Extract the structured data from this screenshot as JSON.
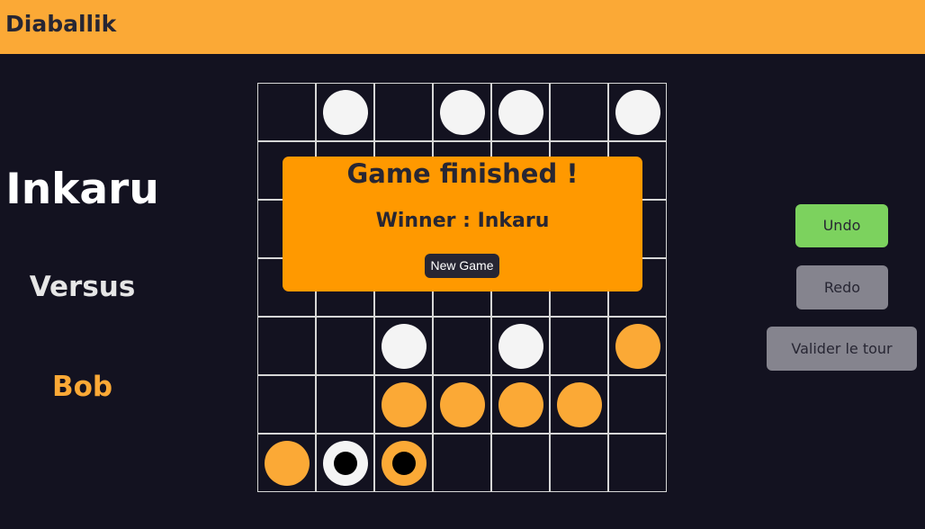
{
  "app": {
    "title": "Diaballik"
  },
  "players": {
    "player1": "Inkaru",
    "versus": "Versus",
    "player2": "Bob"
  },
  "board": {
    "size": 7,
    "rows": [
      [
        "",
        "W",
        "",
        "W",
        "W",
        "",
        "W"
      ],
      [
        "",
        "",
        "",
        "",
        "",
        "",
        ""
      ],
      [
        "",
        "",
        "",
        "",
        "",
        "",
        ""
      ],
      [
        "",
        "",
        "",
        "",
        "",
        "",
        ""
      ],
      [
        "",
        "",
        "W",
        "",
        "W",
        "",
        "O"
      ],
      [
        "",
        "",
        "O",
        "O",
        "O",
        "O",
        ""
      ],
      [
        "O",
        "WB",
        "OB",
        "",
        "",
        "",
        ""
      ]
    ],
    "legend": {
      "W": "white piece",
      "O": "orange piece",
      "WB": "white piece with ball",
      "OB": "orange piece with ball"
    }
  },
  "modal": {
    "title": "Game finished !",
    "winner_text": "Winner : Inkaru",
    "new_game_label": "New Game"
  },
  "controls": {
    "undo_label": "Undo",
    "redo_label": "Redo",
    "validate_label": "Valider le tour"
  },
  "colors": {
    "header": "#fba936",
    "background": "#131220",
    "orange_piece": "#fba936",
    "white_piece": "#f4f4f4",
    "modal": "#ff9900",
    "undo": "#7cd25e",
    "disabled_button": "#85848e"
  }
}
